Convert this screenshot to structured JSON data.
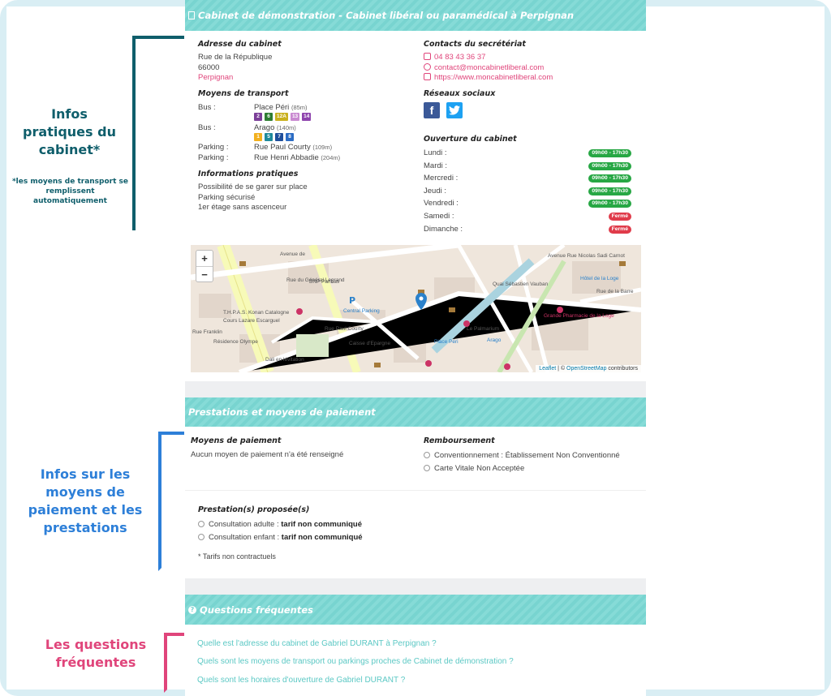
{
  "annotations": {
    "practical_title": "Infos pratiques du cabinet*",
    "practical_note": "*les moyens de transport se remplissent automatiquement",
    "payment_title": "Infos sur les moyens de paiement et les prestations",
    "faq_title": "Les questions fréquentes"
  },
  "header": {
    "title": "Cabinet de démonstration - Cabinet libéral ou paramédical à Perpignan"
  },
  "address": {
    "heading": "Adresse du cabinet",
    "street": "Rue de la République",
    "zip": "66000",
    "city": "Perpignan"
  },
  "contacts": {
    "heading": "Contacts du secrétériat",
    "phone": "04 83 43 36 37",
    "email": "contact@moncabinetliberal.com",
    "website": "https://www.moncabinetliberal.com"
  },
  "transport": {
    "heading": "Moyens de transport",
    "rows": [
      {
        "type": "Bus :",
        "name": "Place Péri",
        "distance": "(85m)"
      },
      {
        "type": "Bus :",
        "name": "Arago",
        "distance": "(140m)"
      },
      {
        "type": "Parking :",
        "name": "Rue Paul Courty",
        "distance": "(109m)"
      },
      {
        "type": "Parking :",
        "name": "Rue Henri Abbadie",
        "distance": "(204m)"
      }
    ],
    "lines_peri": [
      {
        "label": "2",
        "color": "#7b3f98"
      },
      {
        "label": "6",
        "color": "#2e7d32"
      },
      {
        "label": "12A",
        "color": "#c9b11e"
      },
      {
        "label": "13",
        "color": "#c98ad1"
      },
      {
        "label": "14",
        "color": "#8e44ad"
      }
    ],
    "lines_arago": [
      {
        "label": "1",
        "color": "#f2b01e"
      },
      {
        "label": "5",
        "color": "#1f8a9b"
      },
      {
        "label": "7",
        "color": "#1f4e9b"
      },
      {
        "label": "8",
        "color": "#2b6cc4"
      }
    ]
  },
  "social": {
    "heading": "Réseaux sociaux",
    "facebook_icon": "facebook-icon",
    "twitter_icon": "twitter-icon"
  },
  "practical": {
    "heading": "Informations pratiques",
    "lines": [
      "Possibilité de se garer sur place",
      "Parking sécurisé",
      "1er étage sans ascenceur"
    ]
  },
  "hours": {
    "heading": "Ouverture du cabinet",
    "days": [
      {
        "day": "Lundi :",
        "value": "09h00 - 17h30",
        "status": "open"
      },
      {
        "day": "Mardi :",
        "value": "09h00 - 17h30",
        "status": "open"
      },
      {
        "day": "Mercredi :",
        "value": "09h00 - 17h30",
        "status": "open"
      },
      {
        "day": "Jeudi :",
        "value": "09h00 - 17h30",
        "status": "open"
      },
      {
        "day": "Vendredi :",
        "value": "09h00 - 17h30",
        "status": "open"
      },
      {
        "day": "Samedi :",
        "value": "Fermé",
        "status": "closed"
      },
      {
        "day": "Dimanche :",
        "value": "Fermé",
        "status": "closed"
      }
    ],
    "colors": {
      "open": "#27a744",
      "closed": "#e03b4a"
    }
  },
  "map": {
    "zoom_in": "+",
    "zoom_out": "−",
    "attribution_leaflet": "Leaflet",
    "attribution_sep": " | © ",
    "attribution_osm": "OpenStreetMap",
    "attribution_tail": " contributors",
    "labels": [
      "Avenue de",
      "Rue du Général Legrand",
      "Cours Lazare Escarguel",
      "Rue Paul Courty",
      "Central Parking",
      "Place Péri",
      "Arago",
      "Le Palmarium",
      "Quai Sébastien Vauban",
      "Avenue Rue Nicolas Sadi Carnot",
      "Rue de la Barre",
      "Grande Pharmacie de la Loge",
      "Hôtel de la Loge",
      "Résidence Olympe",
      "Rue Franklin",
      "Dali en lévitation",
      "Caisse d'Epargne",
      "T.H.P.A.S. Konan Catalogne",
      "BNP Paribas"
    ]
  },
  "payment": {
    "header": "Prestations et moyens de paiement",
    "methods_heading": "Moyens de paiement",
    "methods_text": "Aucun moyen de paiement n'a été renseigné",
    "refund_heading": "Remboursement",
    "refund_lines": [
      "Conventionnement : Établissement Non Conventionné",
      "Carte Vitale Non Acceptée"
    ]
  },
  "services": {
    "heading": "Prestation(s) proposée(s)",
    "items": [
      {
        "label": "Consultation adulte :",
        "value": "tarif non communiqué"
      },
      {
        "label": "Consultation enfant :",
        "value": "tarif non communiqué"
      }
    ],
    "note": "* Tarifs non contractuels"
  },
  "faq": {
    "header": "Questions fréquentes",
    "questions": [
      "Quelle est l'adresse du cabinet de Gabriel DURANT à Perpignan ?",
      "Quels sont les moyens de transport ou parkings proches de Cabinet de démonstration ?",
      "Quels sont les horaires d'ouverture de Gabriel DURANT ?"
    ]
  }
}
